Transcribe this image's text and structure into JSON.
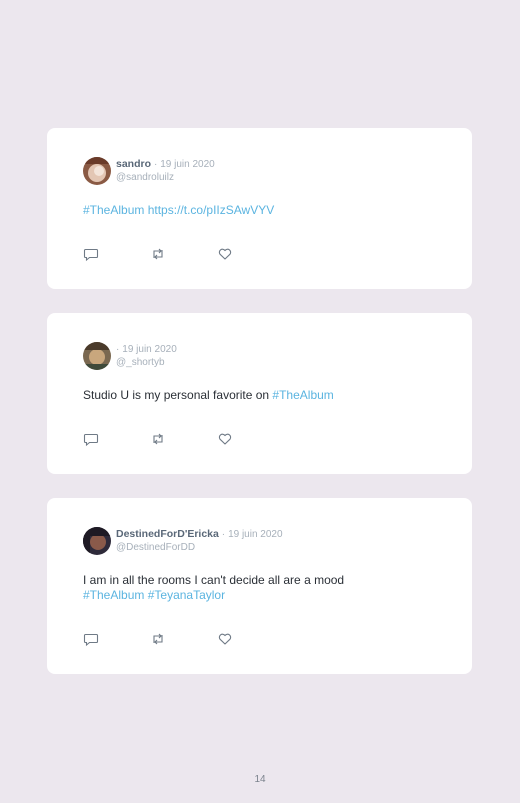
{
  "tweets": [
    {
      "name": "sandro",
      "separator": "·",
      "date": "19 juin 2020",
      "handle": "@sandroluilz",
      "text_plain": "",
      "links": [
        "#TheAlbum",
        "https://t.co/pIIzSAwVYV"
      ]
    },
    {
      "name": "",
      "separator": "·",
      "date": "19 juin 2020",
      "handle": "@_shortyb",
      "text_plain": "Studio U is my personal favorite on ",
      "links": [
        "#TheAlbum"
      ]
    },
    {
      "name": "DestinedForD'Ericka",
      "separator": "·",
      "date": "19 juin 2020",
      "handle": "@DestinedForDD",
      "text_plain": "I am in all the rooms I can't decide all are a mood",
      "links": [
        "#TheAlbum",
        "#TeyanaTaylor"
      ]
    }
  ],
  "icons": {
    "reply": "reply-icon",
    "retweet": "retweet-icon",
    "like": "heart-icon"
  },
  "colors": {
    "background": "#ece7ee",
    "card": "#ffffff",
    "link": "#5bb4e0",
    "name": "#5a6878",
    "muted": "#a7b0ba",
    "icon": "#6f7a86"
  },
  "page_number": "14"
}
